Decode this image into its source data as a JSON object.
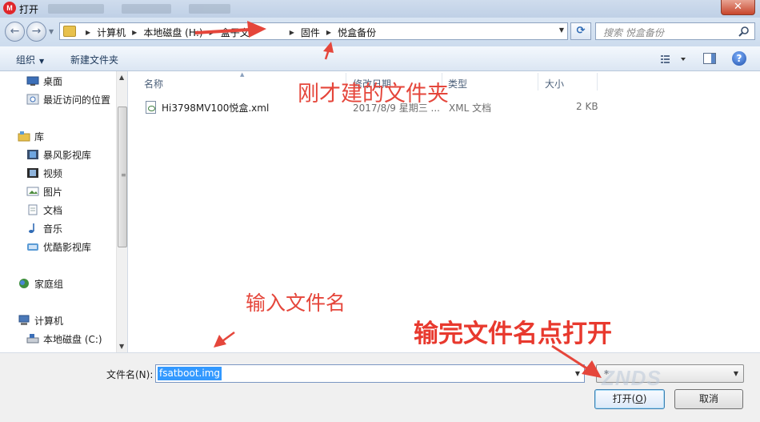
{
  "window": {
    "title": "打开",
    "close_glyph": "✕",
    "app_badge": "M"
  },
  "address": {
    "crumbs": [
      "计算机",
      "本地磁盘 (H:)",
      "盒子文",
      "固件",
      "悦盒备份"
    ],
    "search_placeholder": "搜索 悦盒备份"
  },
  "toolbar": {
    "organize_label": "组织",
    "new_folder_label": "新建文件夹",
    "help_glyph": "?"
  },
  "sidebar": {
    "items": [
      {
        "label": "桌面",
        "icon": "desktop-icon"
      },
      {
        "label": "最近访问的位置",
        "icon": "recent-places-icon"
      },
      {
        "label": "库",
        "icon": "library-icon"
      },
      {
        "label": "暴风影视库",
        "icon": "video-library-icon"
      },
      {
        "label": "视频",
        "icon": "video-icon"
      },
      {
        "label": "图片",
        "icon": "picture-icon"
      },
      {
        "label": "文档",
        "icon": "document-icon"
      },
      {
        "label": "音乐",
        "icon": "music-icon"
      },
      {
        "label": "优酷影视库",
        "icon": "video-library-icon"
      },
      {
        "label": "家庭组",
        "icon": "homegroup-icon"
      },
      {
        "label": "计算机",
        "icon": "computer-icon"
      },
      {
        "label": "本地磁盘 (C:)",
        "icon": "drive-icon"
      }
    ]
  },
  "file_list": {
    "columns": [
      "名称",
      "修改日期",
      "类型",
      "大小"
    ],
    "rows": [
      {
        "name": "Hi3798MV100悦盒.xml",
        "date": "2017/8/9 星期三 ...",
        "type": "XML 文档",
        "size": "2 KB",
        "icon": "xml-file-icon"
      }
    ]
  },
  "bottom": {
    "filename_label": "文件名(N):",
    "filename_value": "fsatboot.img",
    "file_type_value": "*",
    "open_label_main": "打开(",
    "open_label_key": "O",
    "open_label_end": ")",
    "cancel_label": "取消"
  },
  "annotations": {
    "folder_note": "刚才建的文件夹",
    "input_note": "输入文件名",
    "open_note": "输完文件名点打开",
    "color": "#e5463b"
  },
  "watermark": {
    "text": "ZNDS"
  }
}
